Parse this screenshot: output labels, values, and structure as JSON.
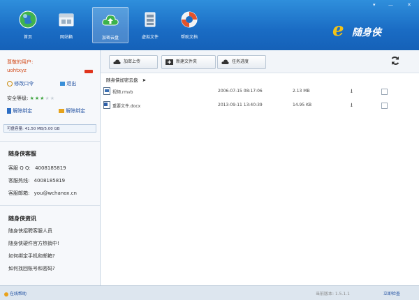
{
  "window": {
    "minimize": "—",
    "close": "✕",
    "menu": "▾"
  },
  "nav": [
    {
      "label": "首页",
      "icon": "globe-icon"
    },
    {
      "label": "网站箱",
      "icon": "box-icon"
    },
    {
      "label": "加密云盘",
      "icon": "cloud-upload-icon"
    },
    {
      "label": "虚拟文件",
      "icon": "file-cabinet-icon"
    },
    {
      "label": "帮助文档",
      "icon": "lifebuoy-icon"
    }
  ],
  "brand": {
    "letter": "e",
    "name": "随身侠"
  },
  "sidebar": {
    "greeting": "尊敬的用户:",
    "username": "uohtxyz",
    "badge": "",
    "edit_password": "修改口令",
    "logout": "退出",
    "security_label": "安全等级:",
    "security_stars": 3,
    "security_max": 5,
    "bind_phone": "解除绑定",
    "bind_email": "解除绑定",
    "capacity": "可盘容量: 41.50 MB/5.00 GB",
    "service_title": "随身侠客服",
    "service": [
      {
        "label": "客服 Q Q:",
        "value": "4008185819"
      },
      {
        "label": "客服热线:",
        "value": "4008185819"
      },
      {
        "label": "客服邮箱:",
        "value": "you@wchanox.cn"
      }
    ],
    "news_title": "随身侠资讯",
    "news": [
      "随身侠招聘客服人员",
      "随身侠硬件官方热销中!",
      "如何绑定手机和邮箱?",
      "如何找回账号和密码?"
    ]
  },
  "toolbar": {
    "upload": "加密上传",
    "new_folder": "新建文件夹",
    "tasks": "任务进度",
    "refresh_icon": "refresh-icon"
  },
  "breadcrumb": {
    "label": "随身侠加密云盘",
    "arrow": "➤"
  },
  "files": [
    {
      "name": "视频.rmvb",
      "date": "2006-07-15 08:17:06",
      "size": "2.13 MB",
      "download": "⭳"
    },
    {
      "name": "重要文件.docx",
      "date": "2013-09-11 13:40:39",
      "size": "14.95 KB",
      "download": "⭳"
    }
  ],
  "status": {
    "help": "在线帮助",
    "version": "当前版本: 1.5.1.1",
    "settings": "立即检查"
  }
}
